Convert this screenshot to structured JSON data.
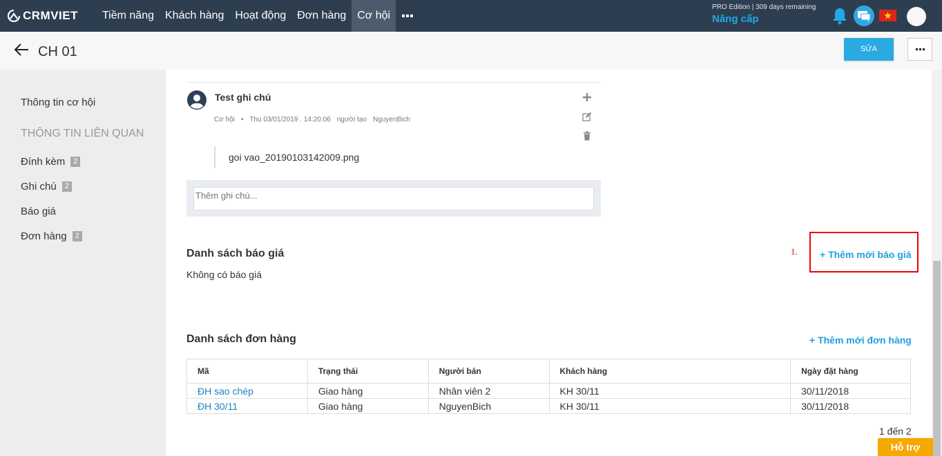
{
  "topbar": {
    "brand": "CRMVIET",
    "nav": [
      "Tiềm năng",
      "Khách hàng",
      "Hoạt động",
      "Đơn hàng",
      "Cơ hội"
    ],
    "active_index": 4,
    "edition_text": "PRO Edition | 309 days remaining",
    "upgrade_label": "Nâng cấp",
    "icons": [
      "bell-icon",
      "chat-icon",
      "vietnam-flag-icon",
      "user-avatar"
    ]
  },
  "titlebar": {
    "title": "CH 01",
    "edit_label": "SỬA"
  },
  "sidebar": {
    "info_label": "Thông tin cơ hội",
    "related_header": "THÔNG TIN LIÊN QUAN",
    "items": [
      {
        "label": "Đính kèm",
        "count": "2"
      },
      {
        "label": "Ghi chú",
        "count": "2"
      },
      {
        "label": "Báo giá",
        "count": ""
      },
      {
        "label": "Đơn hàng",
        "count": "2"
      }
    ]
  },
  "note": {
    "title": "Test ghi chú",
    "meta_type": "Cơ hội",
    "meta_sep": "•",
    "meta_time": "Thu 03/01/2019 . 14:20:06",
    "meta_creator_label": "người tạo",
    "meta_creator": "NguyenBich",
    "attachment": "goi vao_20190103142009.png",
    "input_placeholder": "Thêm ghi chú..."
  },
  "quotes": {
    "title": "Danh sách báo giá",
    "empty_text": "Không có báo giá",
    "add_label": "+ Thêm mới báo giá",
    "marker": "1."
  },
  "orders": {
    "title": "Danh sách đơn hàng",
    "add_label": "+ Thêm mới đơn hàng",
    "columns": [
      "Mã",
      "Trạng thái",
      "Người bán",
      "Khách hàng",
      "Ngày đặt hàng"
    ],
    "rows": [
      [
        "ĐH sao chép",
        "Giao hàng",
        "Nhân viên 2",
        "KH 30/11",
        "30/11/2018"
      ],
      [
        "ĐH 30/11",
        "Giao hàng",
        "NguyenBich",
        "KH 30/11",
        "30/11/2018"
      ]
    ],
    "pagination": "1 đến 2"
  },
  "support_label": "Hỗ trợ",
  "colors": {
    "navbar": "#2d3e50",
    "accent": "#29abe2",
    "link": "#1e9fde",
    "highlight": "#e00000",
    "support": "#f5a800"
  }
}
